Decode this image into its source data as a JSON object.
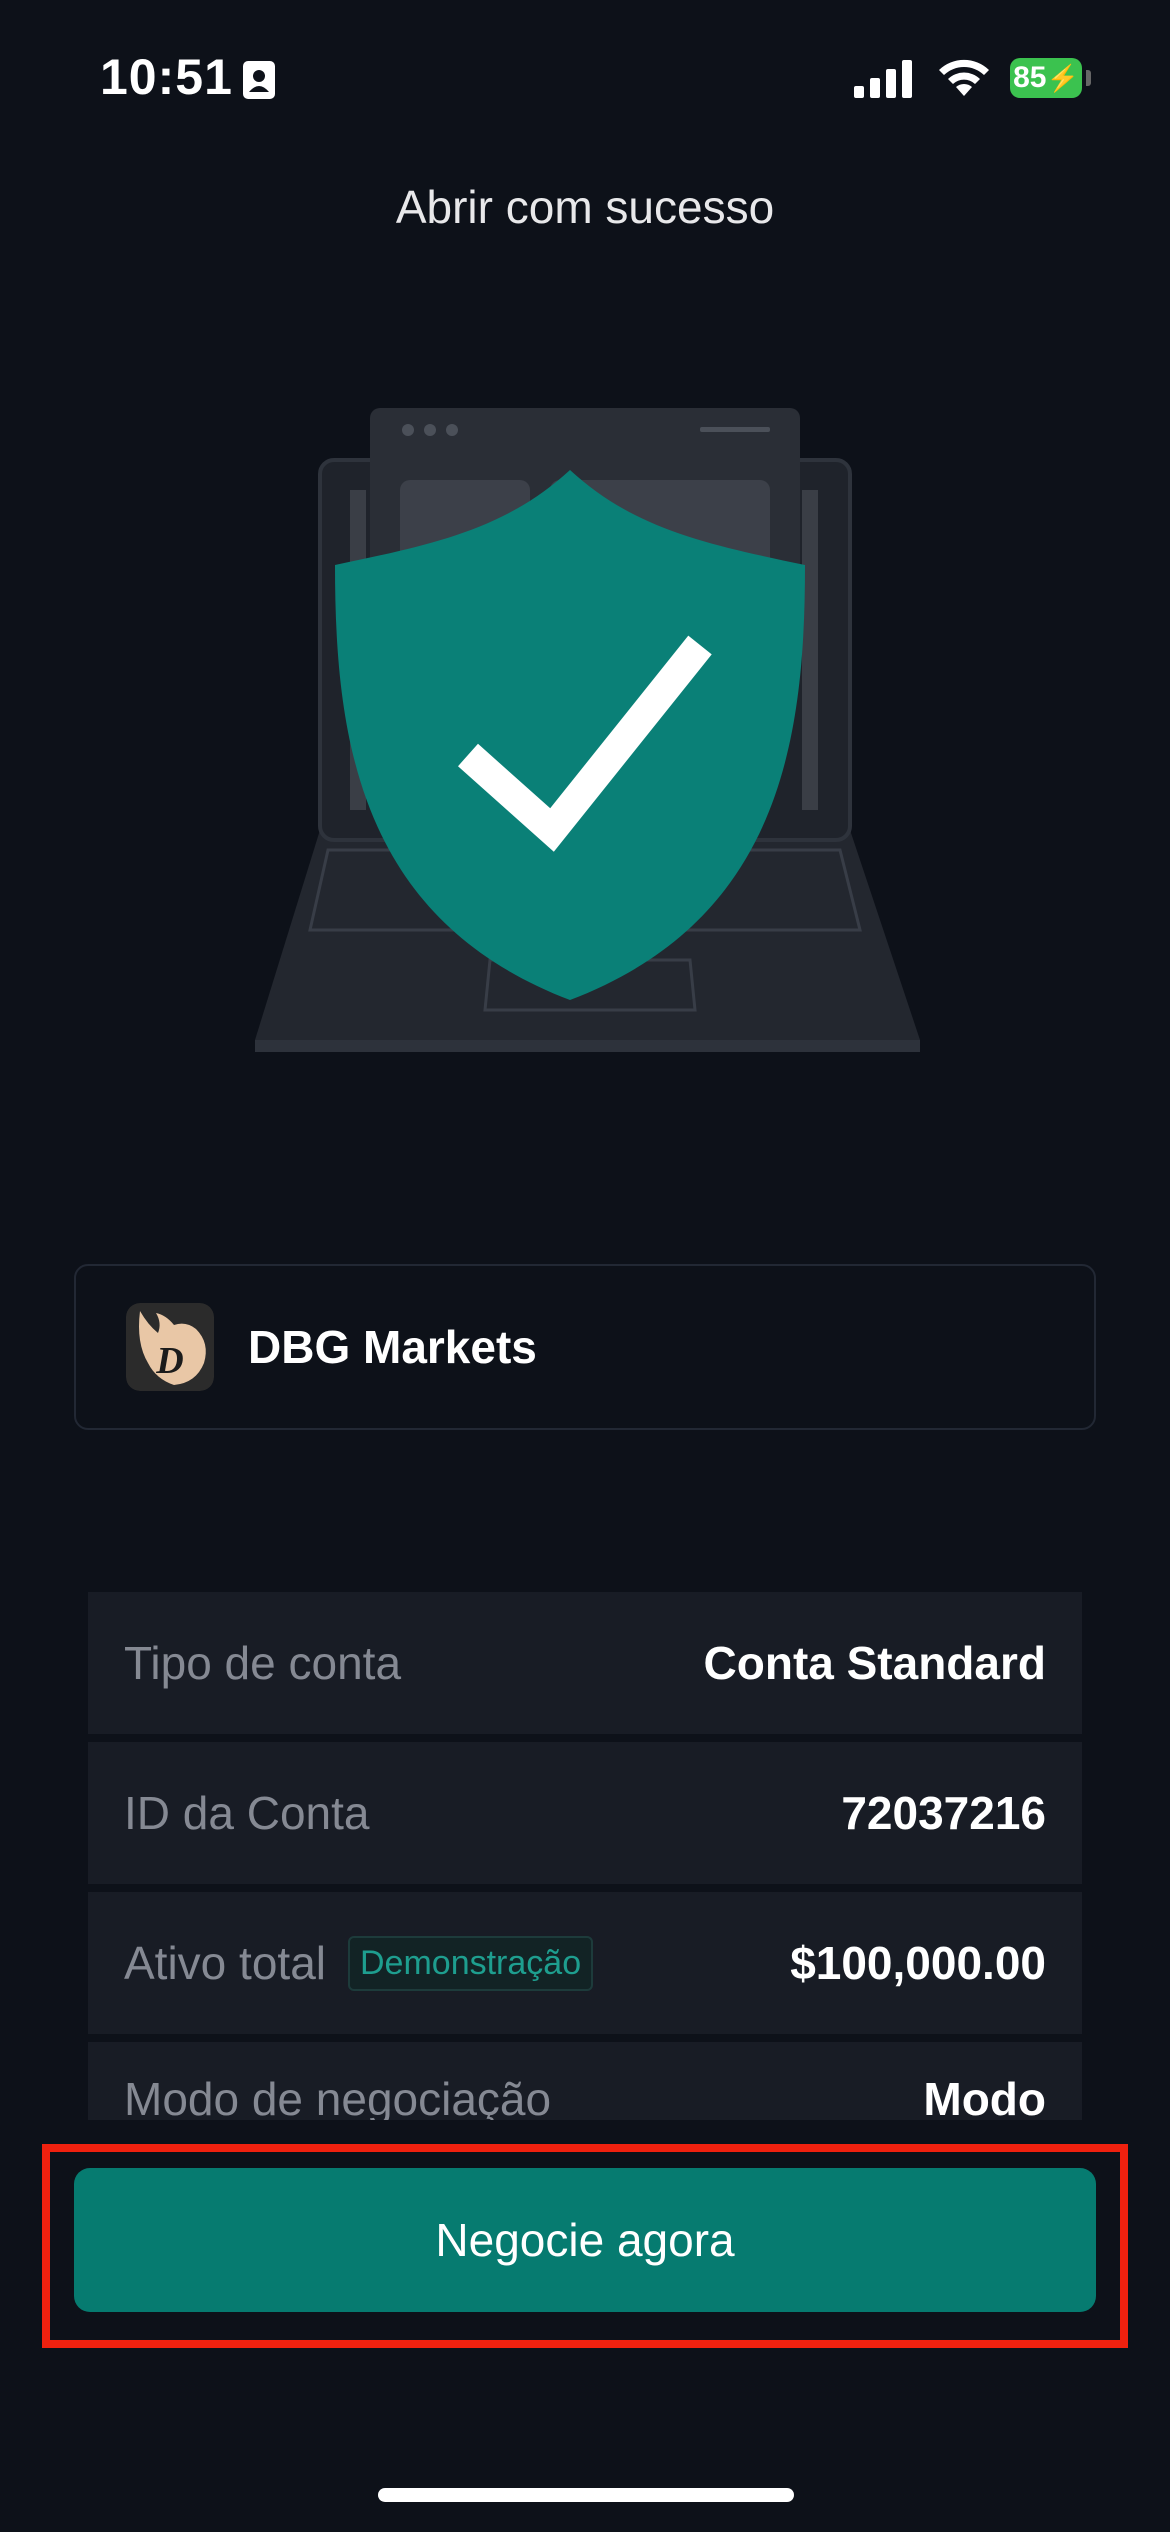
{
  "status_bar": {
    "time": "10:51",
    "battery": "85"
  },
  "page": {
    "title": "Abrir com sucesso"
  },
  "broker": {
    "name": "DBG Markets"
  },
  "account_info": {
    "rows": [
      {
        "label": "Tipo de conta",
        "value": "Conta Standard"
      },
      {
        "label": "ID da Conta",
        "value": "72037216"
      },
      {
        "label": "Ativo total",
        "badge": "Demonstração",
        "value": "$100,000.00"
      },
      {
        "label": "Modo de negociação",
        "value": "Modo"
      }
    ]
  },
  "actions": {
    "trade_now": "Negocie agora"
  },
  "colors": {
    "background": "#0d1119",
    "accent": "#067b70",
    "shield": "#0a8077",
    "highlight": "#f0210f"
  },
  "icons": [
    "contact-card-icon",
    "signal-icon",
    "wifi-icon",
    "battery-icon",
    "shield-check-icon",
    "dbg-logo-icon"
  ]
}
